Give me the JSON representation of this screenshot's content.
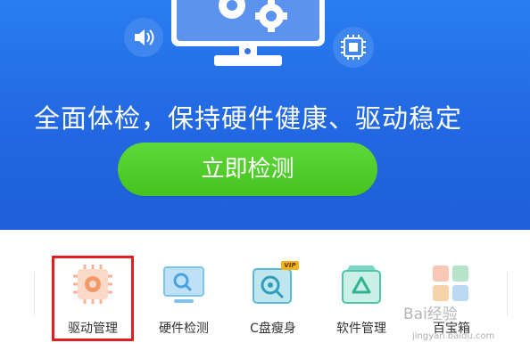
{
  "hero": {
    "headline": "全面体检，保持硬件健康、驱动稳定",
    "cta_label": "立即检测"
  },
  "tools": [
    {
      "label": "驱动管理",
      "icon": "chip-gear-icon",
      "selected": true
    },
    {
      "label": "硬件检测",
      "icon": "monitor-search-icon"
    },
    {
      "label": "C盘瘦身",
      "icon": "disk-clean-icon",
      "badge": "VIP"
    },
    {
      "label": "软件管理",
      "icon": "software-box-icon"
    },
    {
      "label": "百宝箱",
      "icon": "grid-apps-icon"
    }
  ],
  "watermark": {
    "text": "Bai经验",
    "sub": "jingyan.baidu.com"
  },
  "colors": {
    "hero_blue": "#2268e2",
    "cta_green": "#46c31f",
    "highlight_red": "#e02020"
  }
}
